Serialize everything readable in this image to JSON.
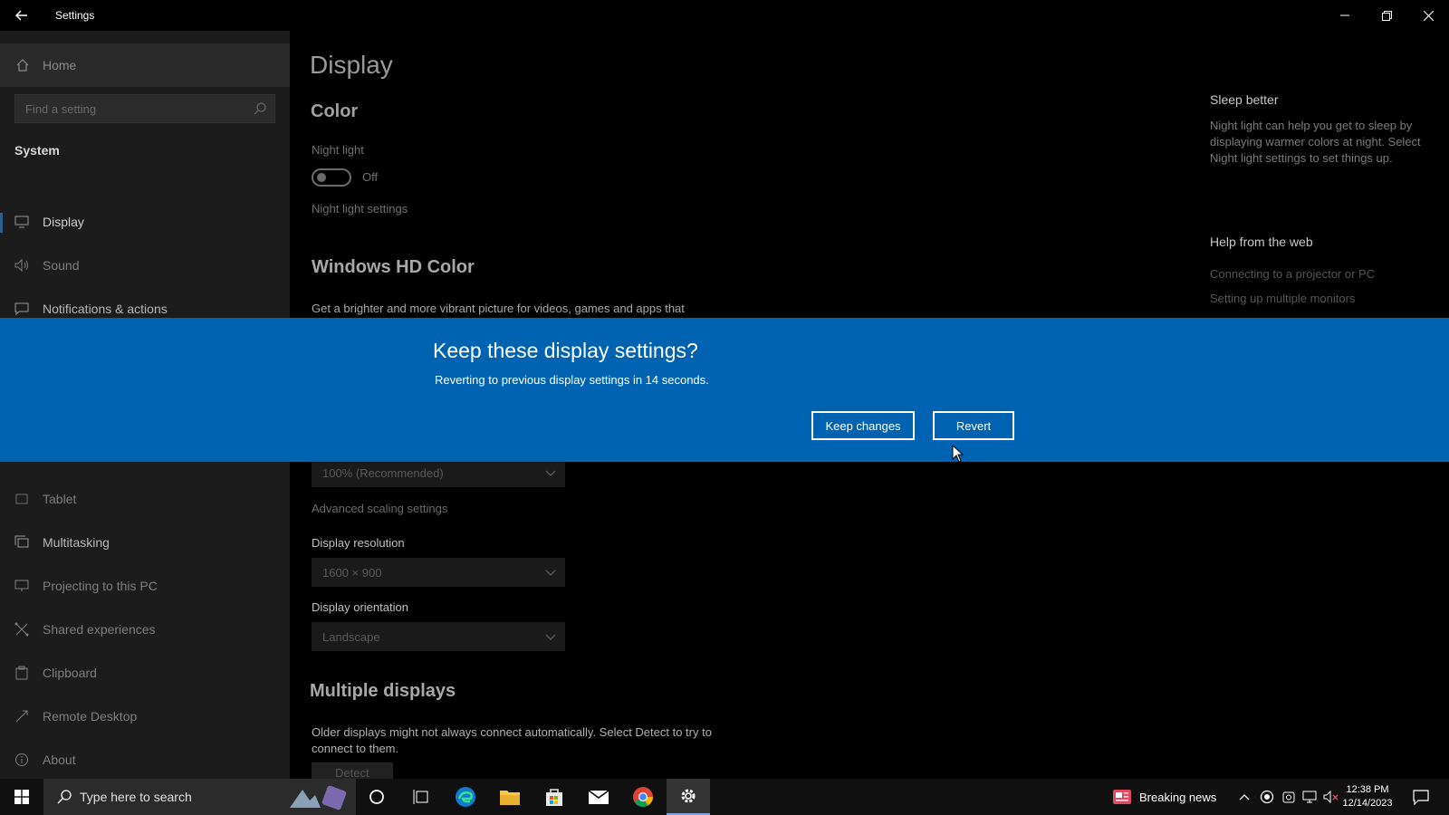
{
  "window": {
    "title": "Settings"
  },
  "sidebar": {
    "home_label": "Home",
    "search_placeholder": "Find a setting",
    "section": "System",
    "items": [
      {
        "label": "Display",
        "icon": "monitor-icon"
      },
      {
        "label": "Sound",
        "icon": "speaker-icon"
      },
      {
        "label": "Notifications & actions",
        "icon": "message-icon"
      },
      {
        "label": "Tablet",
        "icon": "tablet-icon"
      },
      {
        "label": "Multitasking",
        "icon": "multitasking-icon"
      },
      {
        "label": "Projecting to this PC",
        "icon": "project-icon"
      },
      {
        "label": "Shared experiences",
        "icon": "share-icon"
      },
      {
        "label": "Clipboard",
        "icon": "clipboard-icon"
      },
      {
        "label": "Remote Desktop",
        "icon": "remote-icon"
      },
      {
        "label": "About",
        "icon": "info-icon"
      }
    ]
  },
  "main": {
    "page_title": "Display",
    "color_heading": "Color",
    "night_light_label": "Night light",
    "night_light_state": "Off",
    "night_light_settings_link": "Night light settings",
    "hd_color_heading": "Windows HD Color",
    "hd_color_desc": "Get a brighter and more vibrant picture for videos, games and apps that",
    "scale_value": "100% (Recommended)",
    "advanced_scaling_link": "Advanced scaling settings",
    "resolution_label": "Display resolution",
    "resolution_value": "1600 × 900",
    "orientation_label": "Display orientation",
    "orientation_value": "Landscape",
    "multiple_heading": "Multiple displays",
    "multiple_desc": "Older displays might not always connect automatically. Select Detect to try to connect to them.",
    "detect_label": "Detect"
  },
  "aside": {
    "sleep_title": "Sleep better",
    "sleep_text": "Night light can help you get to sleep by displaying warmer colors at night. Select Night light settings to set things up.",
    "help_title": "Help from the web",
    "help_links": [
      "Connecting to a projector or PC",
      "Setting up multiple monitors"
    ]
  },
  "dialog": {
    "title": "Keep these display settings?",
    "subtitle": "Reverting to previous display settings in 14 seconds.",
    "keep_label": "Keep changes",
    "revert_label": "Revert",
    "accent": "#0063b1"
  },
  "taskbar": {
    "search_placeholder": "Type here to search",
    "news_label": "Breaking news",
    "time": "12:38 PM",
    "date": "12/14/2023"
  }
}
